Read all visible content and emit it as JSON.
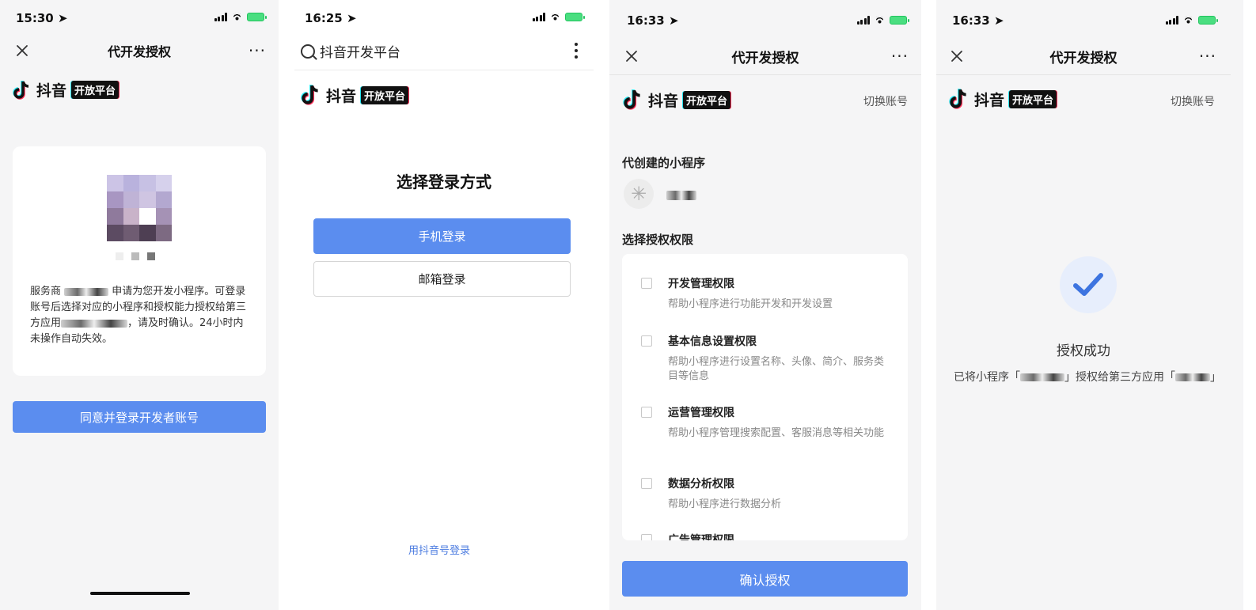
{
  "screen1": {
    "time": "15:30 ➤",
    "nav_title": "代开发授权",
    "brand_name": "抖音",
    "brand_tag": "开放平台",
    "desc_a": "服务商 ",
    "desc_b": " 申请为您开发小程序。可登录账号后选择对应的小程序和授权能力授权给第三方应用",
    "desc_c": "，请及时确认。24小时内未操作自动失效。",
    "agree_button": "同意并登录开发者账号"
  },
  "screen2": {
    "time": "16:25 ➤",
    "search_title": "抖音开发平台",
    "brand_name": "抖音",
    "brand_tag": "开放平台",
    "heading": "选择登录方式",
    "phone_login": "手机登录",
    "email_login": "邮箱登录",
    "douyin_login": "用抖音号登录"
  },
  "screen3": {
    "time": "16:33 ➤",
    "nav_title": "代开发授权",
    "brand_name": "抖音",
    "brand_tag": "开放平台",
    "switch_account": "切换账号",
    "created_title": "代创建的小程序",
    "perm_title": "选择授权权限",
    "permissions": [
      {
        "title": "开发管理权限",
        "desc": "帮助小程序进行功能开发和开发设置"
      },
      {
        "title": "基本信息设置权限",
        "desc": "帮助小程序进行设置名称、头像、简介、服务类目等信息"
      },
      {
        "title": "运营管理权限",
        "desc": "帮助小程序管理搜索配置、客服消息等相关功能"
      },
      {
        "title": "数据分析权限",
        "desc": "帮助小程序进行数据分析"
      },
      {
        "title": "广告管理权限",
        "desc": ""
      }
    ],
    "confirm_button": "确认授权"
  },
  "screen4": {
    "time": "16:33 ➤",
    "nav_title": "代开发授权",
    "brand_name": "抖音",
    "brand_tag": "开放平台",
    "switch_account": "切换账号",
    "success_title": "授权成功",
    "success_a": "已将小程序「",
    "success_b": "」授权给第三方应用「",
    "success_c": "」"
  },
  "colors": {
    "primary": "#5b8def",
    "link": "#4c7ce0",
    "check": "#3d74e0"
  }
}
